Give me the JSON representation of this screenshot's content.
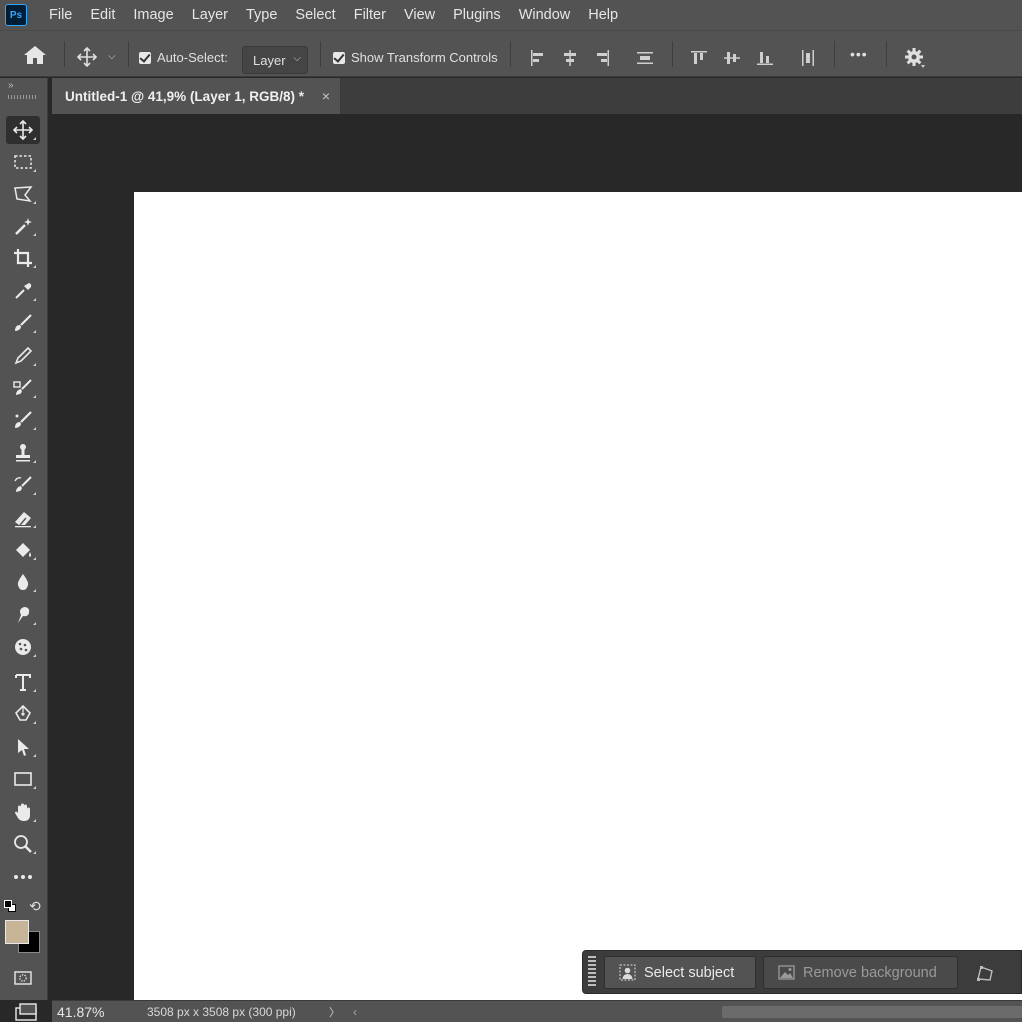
{
  "app": {
    "logo_text": "Ps"
  },
  "menu": [
    "File",
    "Edit",
    "Image",
    "Layer",
    "Type",
    "Select",
    "Filter",
    "View",
    "Plugins",
    "Window",
    "Help"
  ],
  "options": {
    "auto_select_label": "Auto-Select:",
    "auto_select_checked": true,
    "auto_select_target": "Layer",
    "show_transform_label": "Show Transform Controls",
    "show_transform_checked": true,
    "more_label": "•••"
  },
  "document_tab": {
    "title": "Untitled-1 @ 41,9% (Layer 1, RGB/8) *",
    "close_glyph": "×"
  },
  "tools": [
    "move-tool",
    "rectangular-marquee-tool",
    "polygonal-lasso-tool",
    "magic-wand-tool",
    "crop-tool",
    "eyedropper-tool",
    "brush-tool",
    "pencil-tool",
    "mixer-brush-tool",
    "spot-healing-brush-tool",
    "clone-stamp-tool",
    "history-brush-tool",
    "eraser-tool",
    "paint-bucket-tool",
    "blur-tool",
    "smudge-tool",
    "sponge-tool",
    "type-tool",
    "pen-tool",
    "path-selection-tool",
    "rectangle-tool",
    "hand-tool",
    "zoom-tool",
    "edit-toolbar"
  ],
  "colors": {
    "foreground": "#c8b496",
    "background": "#000000",
    "accent": "#31a8ff"
  },
  "taskbar": {
    "select_subject": "Select subject",
    "remove_background": "Remove background"
  },
  "status": {
    "zoom": "41.87%",
    "doc_info": "3508 px x 3508 px (300 ppi)",
    "next_glyph": "〉",
    "prev_glyph": "‹"
  }
}
